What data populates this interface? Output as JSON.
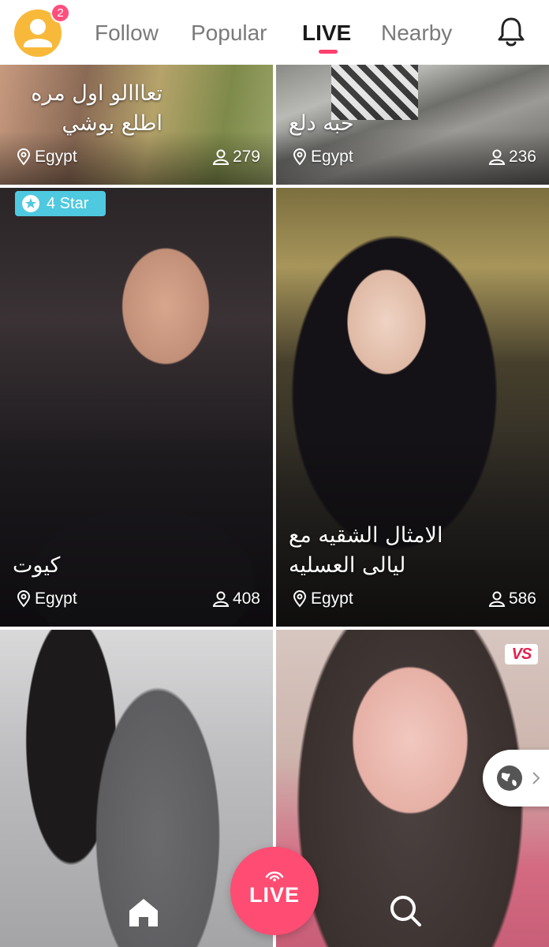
{
  "header": {
    "notification_count": "2",
    "tabs": [
      {
        "label": "Follow",
        "active": false
      },
      {
        "label": "Popular",
        "active": false
      },
      {
        "label": "LIVE",
        "active": true
      },
      {
        "label": "Nearby",
        "active": false
      }
    ],
    "accent_color": "#ff3f6c"
  },
  "streams": [
    {
      "title_line1": "تعااالو اول مره",
      "title_line2": "اطلع بوشي",
      "location": "Egypt",
      "viewers": "279"
    },
    {
      "title_line1": "حبه دلع",
      "location": "Egypt",
      "viewers": "236"
    },
    {
      "badge": "4 Star",
      "title_line1": "كيوت",
      "location": "Egypt",
      "viewers": "408"
    },
    {
      "title_line1": "الامثال الشقيه مع",
      "title_line2": "ليالى العسليه",
      "location": "Egypt",
      "viewers": "586"
    },
    {},
    {
      "badge": "VS"
    }
  ],
  "bottom_bar": {
    "live_label": "LIVE",
    "live_color": "#ff4c72"
  },
  "icons": [
    "user-avatar-icon",
    "location-pin-icon",
    "viewers-person-icon",
    "star-icon",
    "bell-icon",
    "globe-icon",
    "chevron-right-icon",
    "home-icon",
    "search-icon",
    "live-broadcast-icon"
  ]
}
